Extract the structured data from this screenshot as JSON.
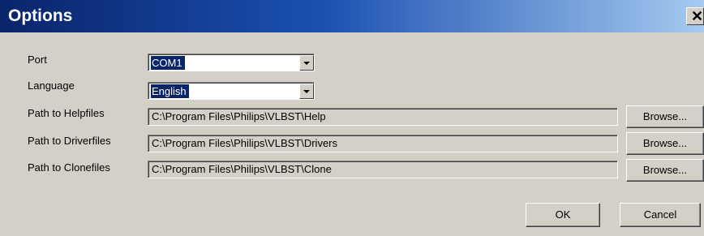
{
  "dialog": {
    "title": "Options",
    "close_icon": "close-icon"
  },
  "port": {
    "label": "Port",
    "value": "COM1"
  },
  "language": {
    "label": "Language",
    "value": "English"
  },
  "helpfiles": {
    "label": "Path to Helpfiles",
    "value": "C:\\Program Files\\Philips\\VLBST\\Help",
    "browse_label": "Browse..."
  },
  "driverfiles": {
    "label": "Path to Driverfiles",
    "value": "C:\\Program Files\\Philips\\VLBST\\Drivers",
    "browse_label": "Browse..."
  },
  "clonefiles": {
    "label": "Path to Clonefiles",
    "value": "C:\\Program Files\\Philips\\VLBST\\Clone",
    "browse_label": "Browse..."
  },
  "buttons": {
    "ok": "OK",
    "cancel": "Cancel"
  },
  "colors": {
    "title_gradient_start": "#0a246a",
    "title_gradient_end": "#a6caf0",
    "dialog_face": "#d4d0c8",
    "selection": "#0a246a"
  }
}
